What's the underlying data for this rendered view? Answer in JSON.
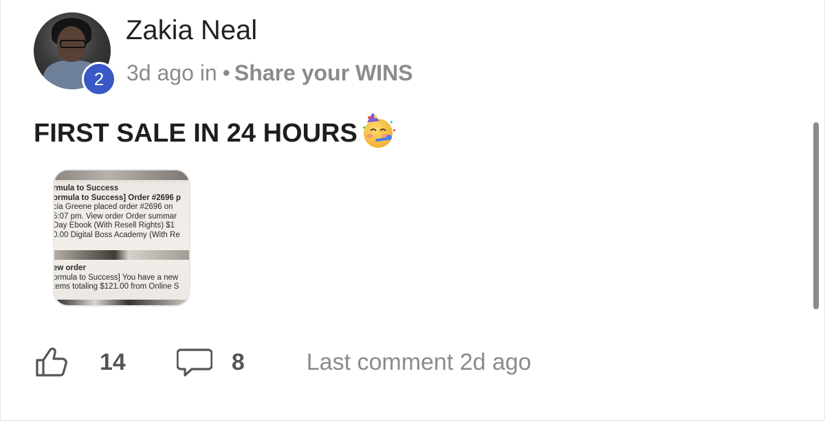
{
  "post": {
    "author": "Zakia Neal",
    "level_badge": "2",
    "time_ago": "3d ago in",
    "separator": "•",
    "group": "Share your WINS",
    "title": "FIRST SALE IN 24 HOURS",
    "emoji": "partying-face"
  },
  "attachment": {
    "lines_top": [
      "rmula to Success",
      "ormula to Success] Order #2696 p",
      "cia Greene placed order #2696 on",
      "5:07 pm. View order Order summar",
      " Day Ebook (With Resell Rights) $1",
      "0.00 Digital Boss Academy (With Re"
    ],
    "lines_bottom": [
      "ew order",
      "ormula to Success] You have a new",
      "tems totaling $121.00 from Online S"
    ]
  },
  "actions": {
    "like_icon": "thumbs-up-icon",
    "likes": "14",
    "comment_icon": "comment-bubble-icon",
    "comments": "8",
    "last_comment": "Last comment 2d ago"
  },
  "colors": {
    "badge": "#3a58c6",
    "muted_text": "#8b8b8b",
    "title_text": "#1e1e1e"
  }
}
